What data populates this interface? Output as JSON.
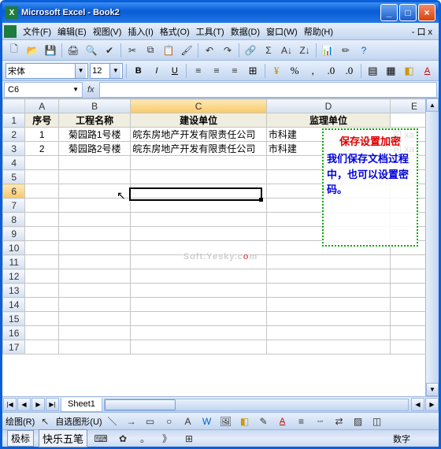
{
  "window": {
    "title": "Microsoft Excel - Book2"
  },
  "menu": {
    "file": "文件(F)",
    "edit": "编辑(E)",
    "view": "视图(V)",
    "insert": "插入(I)",
    "format": "格式(O)",
    "tools": "工具(T)",
    "data": "数据(D)",
    "window": "窗口(W)",
    "help": "帮助(H)",
    "close_doc": "- 口 x"
  },
  "font": {
    "name": "宋体",
    "size": "12"
  },
  "namebox": "C6",
  "columns": {
    "A": "A",
    "B": "B",
    "C": "C",
    "D": "D",
    "E": "E"
  },
  "headers": {
    "seq": "序号",
    "name": "工程名称",
    "builder": "建设单位",
    "supervisor": "监理单位"
  },
  "rows": [
    {
      "n": "1",
      "seq": "1",
      "name": "菊园路1号楼",
      "builder": "皖东房地产开发有限责任公司",
      "supervisor": "市科建",
      "e": "司   xa"
    },
    {
      "n": "2",
      "seq": "2",
      "name": "菊园路2号楼",
      "builder": "皖东房地产开发有限责任公司",
      "supervisor": "市科建",
      "e": "司   xa"
    }
  ],
  "emptyrows": [
    "4",
    "5",
    "6",
    "7",
    "8",
    "9",
    "10",
    "11",
    "12",
    "13",
    "14",
    "15",
    "16",
    "17"
  ],
  "callout": {
    "title": "保存设置加密",
    "body": "我们保存文档过程中，也可以设置密码。"
  },
  "sheet": {
    "tab": "Sheet1"
  },
  "drawbar": {
    "label": "绘图(R)",
    "autoshape": "自选图形(U)"
  },
  "status": {
    "ime1": "极标",
    "ime2": "快乐五笔",
    "num": "数字"
  },
  "watermark": {
    "t1": "Soft.Yesky.c",
    "t2": "o",
    "t3": "m"
  }
}
